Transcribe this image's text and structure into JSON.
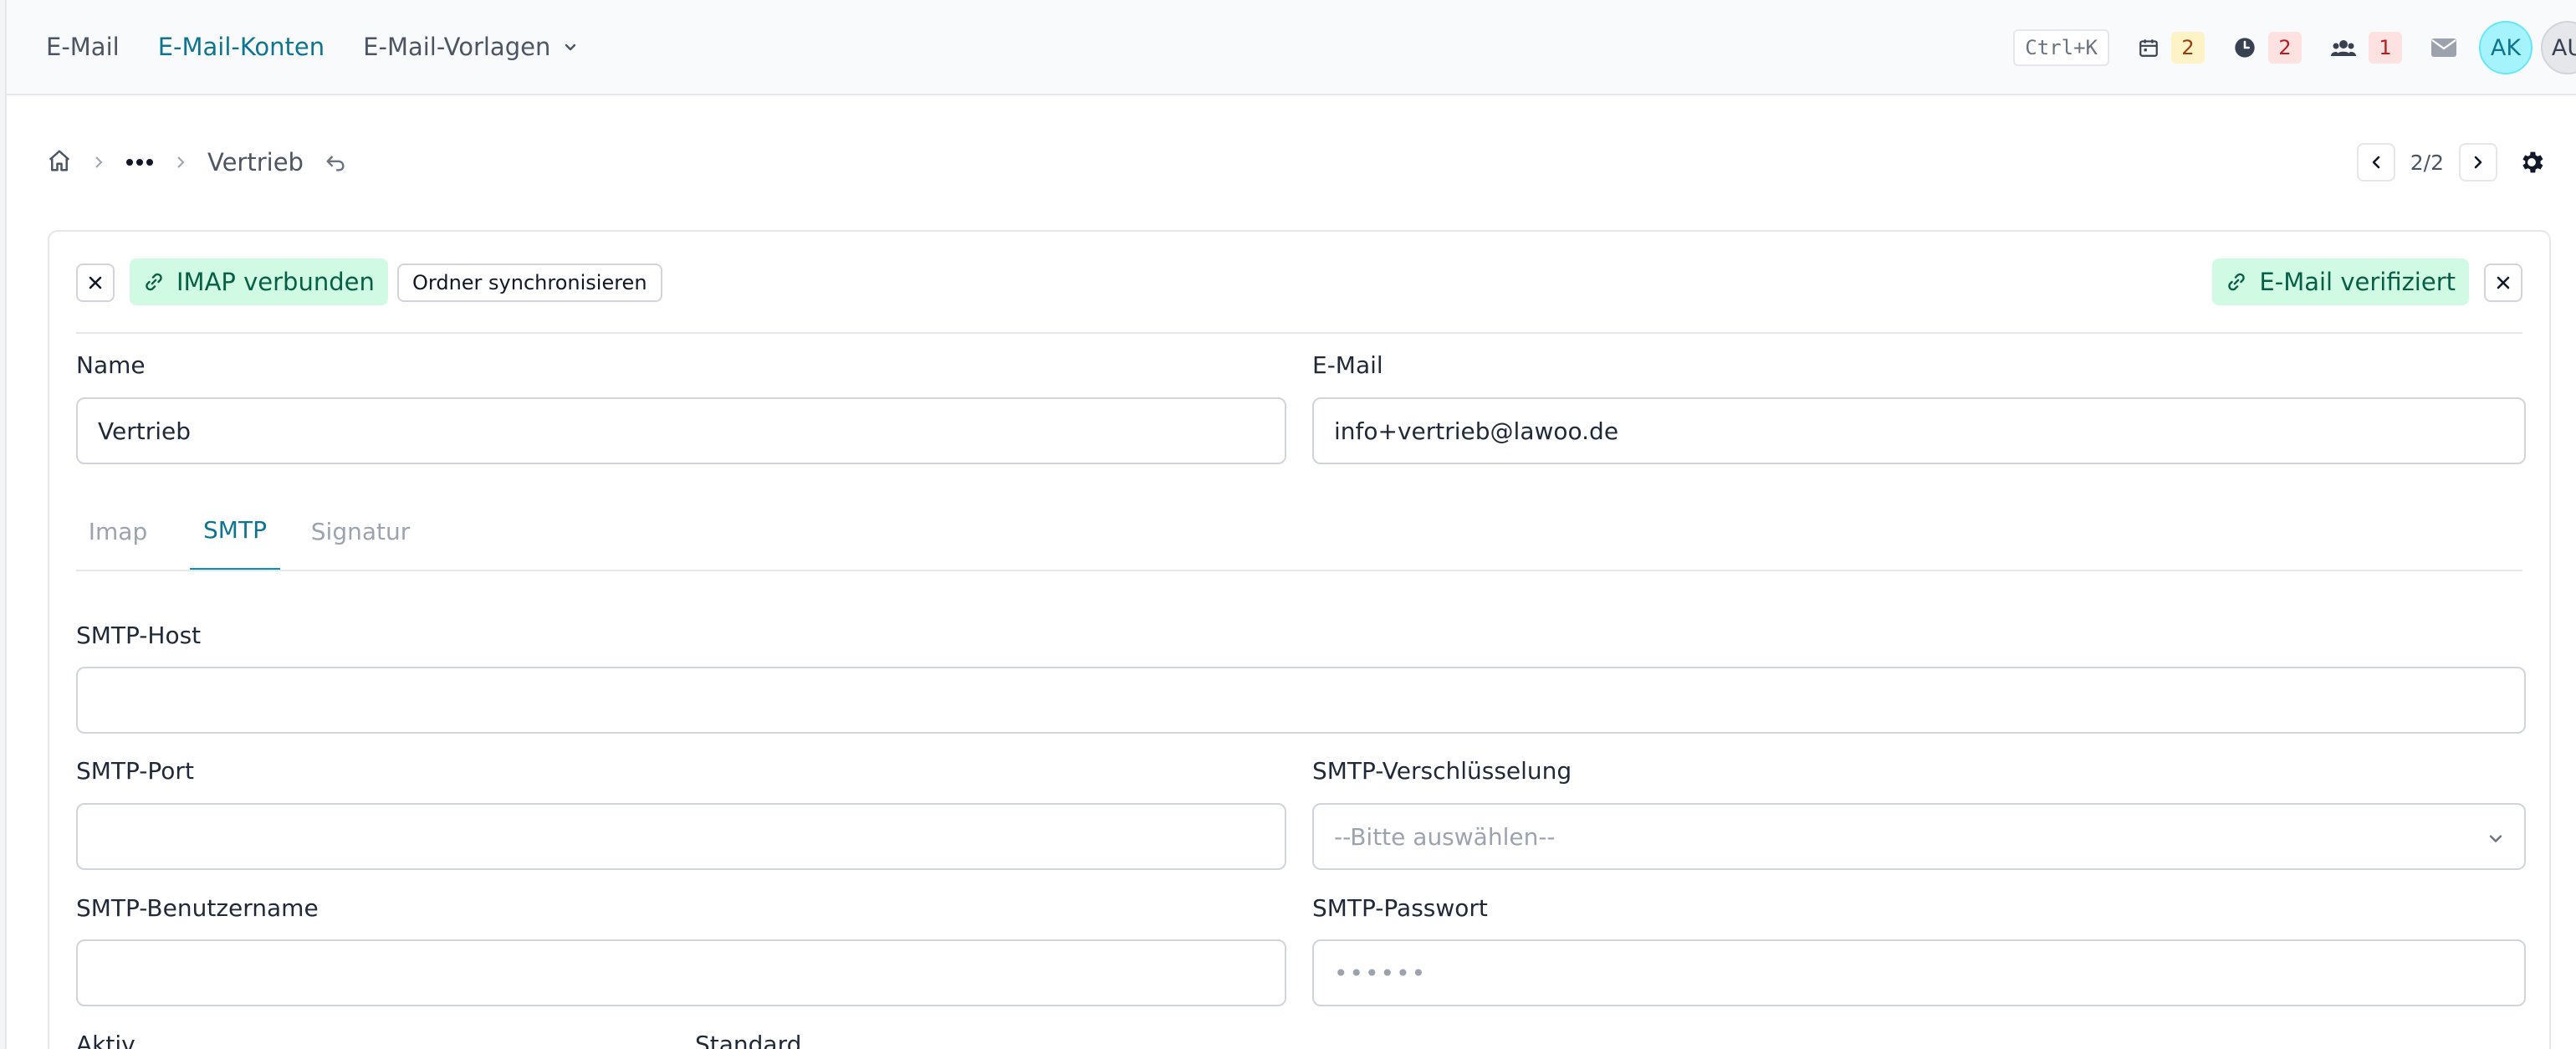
{
  "nav": {
    "links": [
      {
        "label": "E-Mail",
        "active": false
      },
      {
        "label": "E-Mail-Konten",
        "active": true
      },
      {
        "label": "E-Mail-Vorlagen",
        "active": false,
        "dropdown": true
      }
    ],
    "shortcut": "Ctrl+K",
    "stats": [
      {
        "icon": "calendar-icon",
        "count": "2",
        "color": "yellow"
      },
      {
        "icon": "clock-icon",
        "count": "2",
        "color": "red"
      },
      {
        "icon": "users-icon",
        "count": "1",
        "color": "red"
      }
    ],
    "mail_icon": "envelope-icon",
    "avatars": [
      "AK",
      "AU"
    ]
  },
  "breadcrumb": {
    "home_icon": "home-icon",
    "more_icon": "more-dots-icon",
    "current": "Vertrieb",
    "undo_icon": "undo-icon"
  },
  "pager": {
    "text": "2/2"
  },
  "actions": {
    "imap_status": "IMAP verbunden",
    "sync_label": "Ordner synchronisieren",
    "email_status": "E-Mail verifiziert"
  },
  "form": {
    "name_label": "Name",
    "name_value": "Vertrieb",
    "email_label": "E-Mail",
    "email_value": "info+vertrieb@lawoo.de"
  },
  "tabs": [
    {
      "label": "Imap",
      "active": false
    },
    {
      "label": "SMTP",
      "active": true
    },
    {
      "label": "Signatur",
      "active": false
    }
  ],
  "smtp": {
    "host_label": "SMTP-Host",
    "host_value": "",
    "port_label": "SMTP-Port",
    "port_value": "",
    "encryption_label": "SMTP-Verschlüsselung",
    "encryption_value": "--Bitte auswählen--",
    "username_label": "SMTP-Benutzername",
    "username_value": "",
    "password_label": "SMTP-Passwort",
    "password_value": "••••••"
  },
  "flags": {
    "active_label": "Aktiv",
    "default_label": "Standard"
  },
  "colors": {
    "accent": "#0e7490",
    "success_bg": "#d1fae5",
    "success_text": "#065f46"
  }
}
